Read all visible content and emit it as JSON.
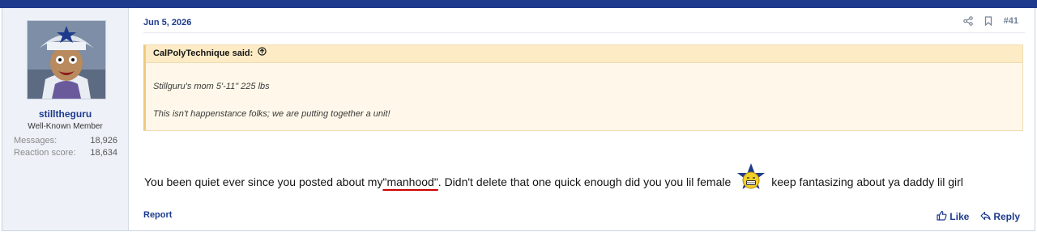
{
  "post": {
    "date": "Jun 5, 2026",
    "number": "#41",
    "author": {
      "username": "stilltheguru",
      "title": "Well-Known Member",
      "stats": [
        {
          "label": "Messages:",
          "value": "18,926"
        },
        {
          "label": "Reaction score:",
          "value": "18,634"
        }
      ]
    },
    "quote": {
      "header": "CalPolyTechnique said:",
      "lines": [
        "Stillguru's mom 5'-11\" 225 lbs",
        "This isn't happenstance folks; we are putting together a unit!"
      ]
    },
    "body": {
      "before": "You been quiet ever since you posted about my ",
      "highlight": "\"manhood\"",
      "middle": ". Didn't delete that one quick enough did you you lil female",
      "after": "keep fantasizing about ya daddy lil girl"
    },
    "footer": {
      "report": "Report",
      "like": "Like",
      "reply": "Reply"
    },
    "icons": [
      "share-icon",
      "bookmark-icon",
      "arrow-up-circle-icon",
      "thumbs-up-icon",
      "reply-icon",
      "star-smiley-icon"
    ]
  },
  "colors": {
    "brand": "#1d3a8c",
    "quote_bg": "#fff8ea",
    "quote_head_bg": "#fdebc6",
    "sidebar_bg": "#eef2f8",
    "underline": "#cc0000"
  }
}
